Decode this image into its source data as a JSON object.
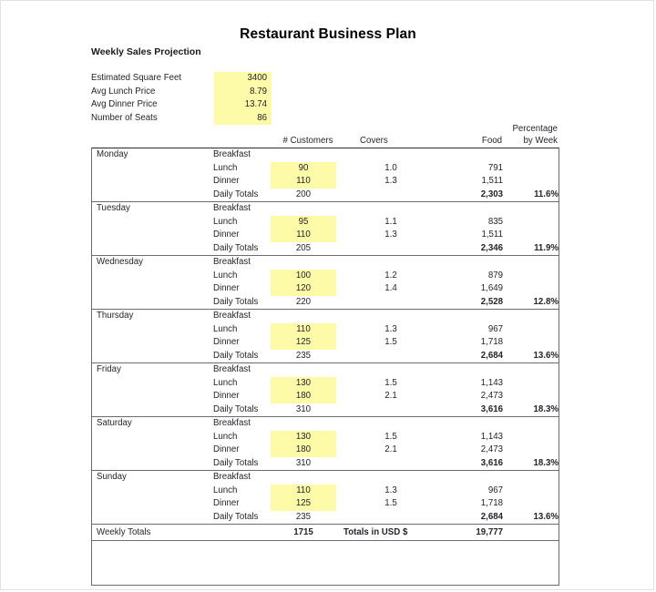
{
  "document": {
    "title": "Restaurant Business Plan",
    "subtitle": "Weekly Sales Projection"
  },
  "parameters": [
    {
      "label": "Estimated Square Feet",
      "value": "3400"
    },
    {
      "label": "Avg Lunch Price",
      "value": "8.79"
    },
    {
      "label": "Avg Dinner Price",
      "value": "13.74"
    },
    {
      "label": "Number of Seats",
      "value": "86"
    }
  ],
  "table": {
    "headers": {
      "customers": "# Customers",
      "covers": "Covers",
      "food": "Food",
      "percentage_line1": "Percentage",
      "percentage_line2": "by Week"
    },
    "meal_labels": {
      "breakfast": "Breakfast",
      "lunch": "Lunch",
      "dinner": "Dinner",
      "daily_totals": "Daily Totals"
    },
    "days": [
      {
        "name": "Monday",
        "breakfast": {
          "customers": "",
          "covers": "",
          "food": ""
        },
        "lunch": {
          "customers": "90",
          "covers": "1.0",
          "food": "791"
        },
        "dinner": {
          "customers": "110",
          "covers": "1.3",
          "food": "1,511"
        },
        "totals": {
          "customers": "200",
          "food": "2,303",
          "percentage": "11.6%"
        }
      },
      {
        "name": "Tuesday",
        "breakfast": {
          "customers": "",
          "covers": "",
          "food": ""
        },
        "lunch": {
          "customers": "95",
          "covers": "1.1",
          "food": "835"
        },
        "dinner": {
          "customers": "110",
          "covers": "1.3",
          "food": "1,511"
        },
        "totals": {
          "customers": "205",
          "food": "2,346",
          "percentage": "11.9%"
        }
      },
      {
        "name": "Wednesday",
        "breakfast": {
          "customers": "",
          "covers": "",
          "food": ""
        },
        "lunch": {
          "customers": "100",
          "covers": "1.2",
          "food": "879"
        },
        "dinner": {
          "customers": "120",
          "covers": "1.4",
          "food": "1,649"
        },
        "totals": {
          "customers": "220",
          "food": "2,528",
          "percentage": "12.8%"
        }
      },
      {
        "name": "Thursday",
        "breakfast": {
          "customers": "",
          "covers": "",
          "food": ""
        },
        "lunch": {
          "customers": "110",
          "covers": "1.3",
          "food": "967"
        },
        "dinner": {
          "customers": "125",
          "covers": "1.5",
          "food": "1,718"
        },
        "totals": {
          "customers": "235",
          "food": "2,684",
          "percentage": "13.6%"
        }
      },
      {
        "name": "Friday",
        "breakfast": {
          "customers": "",
          "covers": "",
          "food": ""
        },
        "lunch": {
          "customers": "130",
          "covers": "1.5",
          "food": "1,143"
        },
        "dinner": {
          "customers": "180",
          "covers": "2.1",
          "food": "2,473"
        },
        "totals": {
          "customers": "310",
          "food": "3,616",
          "percentage": "18.3%"
        }
      },
      {
        "name": "Saturday",
        "breakfast": {
          "customers": "",
          "covers": "",
          "food": ""
        },
        "lunch": {
          "customers": "130",
          "covers": "1.5",
          "food": "1,143"
        },
        "dinner": {
          "customers": "180",
          "covers": "2.1",
          "food": "2,473"
        },
        "totals": {
          "customers": "310",
          "food": "3,616",
          "percentage": "18.3%"
        }
      },
      {
        "name": "Sunday",
        "breakfast": {
          "customers": "",
          "covers": "",
          "food": ""
        },
        "lunch": {
          "customers": "110",
          "covers": "1.3",
          "food": "967"
        },
        "dinner": {
          "customers": "125",
          "covers": "1.5",
          "food": "1,718"
        },
        "totals": {
          "customers": "235",
          "food": "2,684",
          "percentage": "13.6%"
        }
      }
    ],
    "weekly_totals": {
      "label": "Weekly Totals",
      "customers": "1715",
      "currency_note": "Totals in USD $",
      "food": "19,777"
    }
  },
  "colors": {
    "highlight": "#fdfaa8",
    "text": "#22252b",
    "border": "#6d6d6d",
    "header_rule": "#2b2b2b"
  }
}
